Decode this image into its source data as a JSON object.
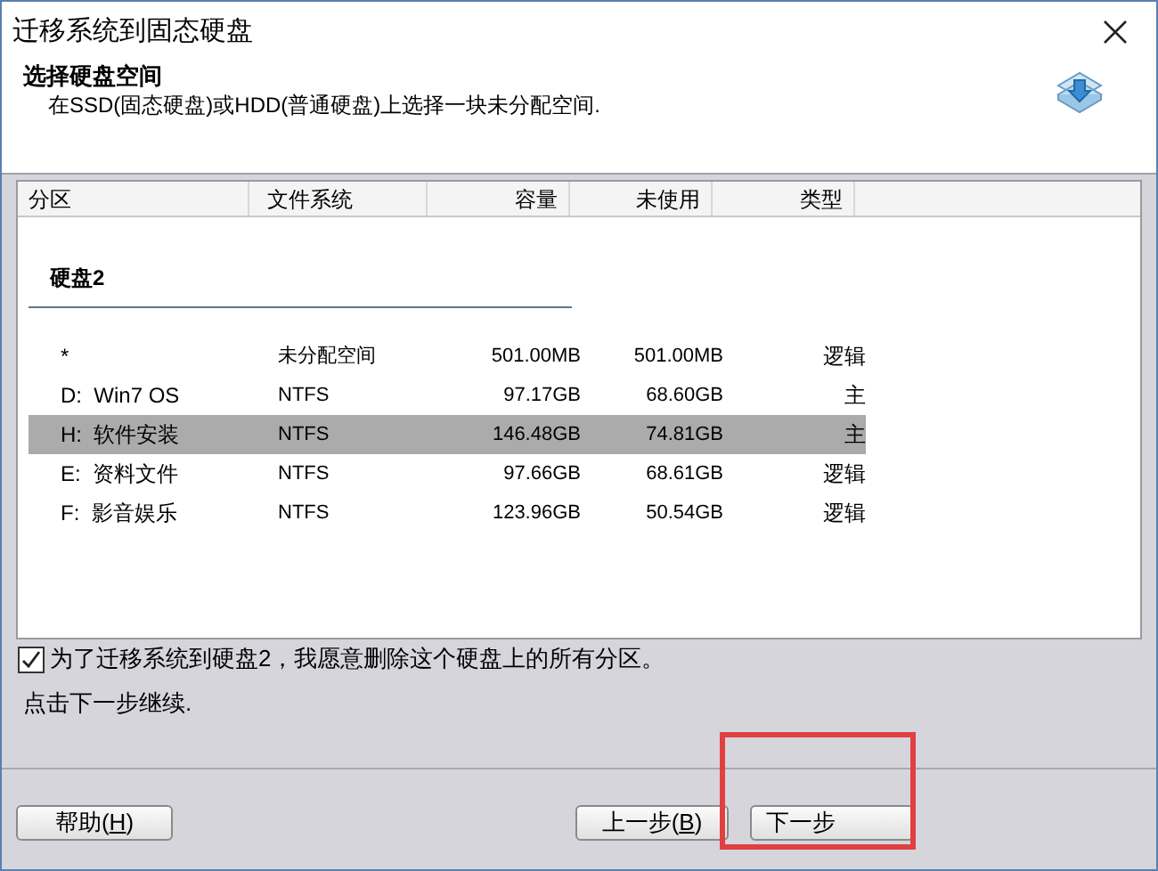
{
  "window": {
    "title": "迁移系统到固态硬盘"
  },
  "header": {
    "title": "选择硬盘空间",
    "subtitle": "在SSD(固态硬盘)或HDD(普通硬盘)上选择一块未分配空间."
  },
  "table": {
    "columns": [
      "分区",
      "文件系统",
      "容量",
      "未使用",
      "类型"
    ],
    "disk": "硬盘2",
    "rows": [
      {
        "cells": [
          "*",
          "未分配空间",
          "501.00MB",
          "501.00MB",
          "逻辑"
        ],
        "selected": false
      },
      {
        "cells": [
          "D:  Win7 OS",
          "NTFS",
          "97.17GB",
          "68.60GB",
          "主"
        ],
        "selected": false
      },
      {
        "cells": [
          "H:  软件安装",
          "NTFS",
          "146.48GB",
          "74.81GB",
          "主"
        ],
        "selected": true
      },
      {
        "cells": [
          "E:  资料文件",
          "NTFS",
          "97.66GB",
          "68.61GB",
          "逻辑"
        ],
        "selected": false
      },
      {
        "cells": [
          "F:  影音娱乐",
          "NTFS",
          "123.96GB",
          "50.54GB",
          "逻辑"
        ],
        "selected": false
      }
    ]
  },
  "confirm": {
    "label": "为了迁移系统到硬盘2，我愿意删除这个硬盘上的所有分区。",
    "checked": true
  },
  "hint": "点击下一步继续.",
  "buttons": [
    {
      "label": "帮助(H)",
      "mnemonic": true
    },
    {
      "label": "上一步(B)",
      "mnemonic": true
    },
    {
      "label": "下一步",
      "mnemonic": false
    }
  ]
}
